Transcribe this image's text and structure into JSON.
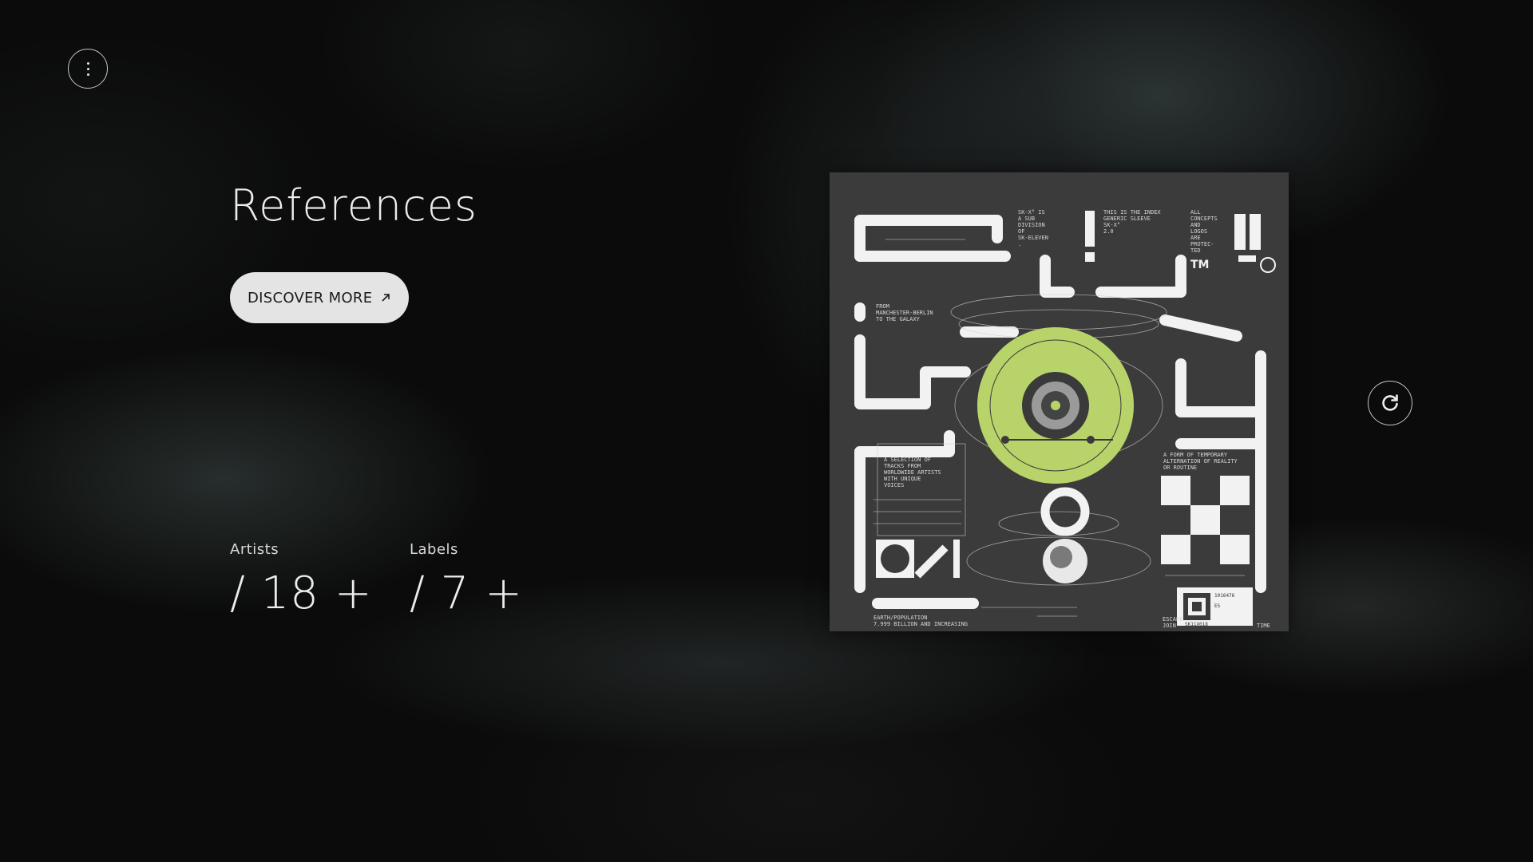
{
  "header": {
    "menu_icon": "more-vertical-icon"
  },
  "hero": {
    "title": "References",
    "discover_label": "DISCOVER MORE",
    "discover_icon": "arrow-up-right-icon"
  },
  "stats": [
    {
      "label": "Artists",
      "value": "/ 18 +"
    },
    {
      "label": "Labels",
      "value": "/ 7 +"
    }
  ],
  "cover": {
    "alt": "SK-Eleven record sleeve artwork",
    "accent_color": "#b8d36a",
    "text_top_1": [
      "SK-X° IS",
      "A SUB",
      "DIVISION",
      "OF",
      "SK-ELEVEN",
      "."
    ],
    "text_top_2": [
      "THIS IS THE INDEX",
      "GENERIC SLEEVE",
      "SK-X°",
      "2.0"
    ],
    "text_top_3": [
      "ALL",
      "CONCEPTS",
      "AND",
      "LOGOS",
      "ARE",
      "PROTEC-",
      "TED"
    ],
    "text_from": [
      "FROM",
      "MANCHESTER-BERLIN",
      "TO THE GALAXY"
    ],
    "text_selection": [
      "A SELECTION OF",
      "TRACKS FROM",
      "WORLDWIDE ARTISTS",
      "WITH UNIQUE",
      "VOICES"
    ],
    "text_form": [
      "A FORM OF TEMPORARY",
      "ALTERNATION OF REALITY",
      "OR ROUTINE"
    ],
    "text_earth": [
      "EARTH/POPULATION",
      "7.999 BILLION AND INCREASING"
    ],
    "text_escape": [
      "ESCAPE",
      "JOIN",
      "TIME"
    ],
    "sticker": [
      "1016476",
      "ES",
      "SK11X018"
    ],
    "tm": "TM"
  },
  "controls": {
    "refresh_icon": "refresh-icon"
  }
}
